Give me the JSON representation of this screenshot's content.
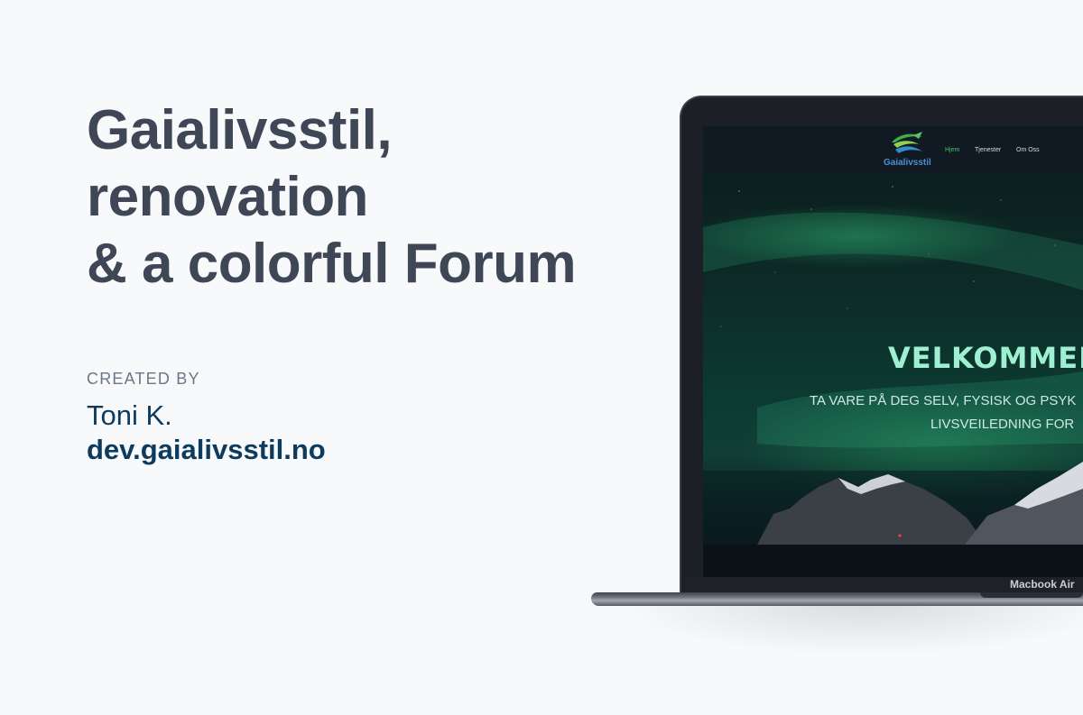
{
  "headline": {
    "line1": "Gaialivsstil,",
    "line2": "renovation",
    "line3": "& a colorful Forum"
  },
  "credits": {
    "label": "CREATED BY",
    "name": "Toni K.",
    "url": "dev.gaialivsstil.no"
  },
  "laptop": {
    "model_label": "Macbook Air"
  },
  "site": {
    "logo_text": "Gaialivsstil",
    "nav": [
      {
        "label": "Hjem",
        "active": true
      },
      {
        "label": "Tjenester",
        "active": false
      },
      {
        "label": "Om Oss",
        "active": false
      }
    ],
    "hero": {
      "title": "VELKOMMEN",
      "subtitle_line1": "TA VARE PÅ DEG SELV, FYSISK OG PSYK",
      "subtitle_line2": "LIVSVEILEDNING FOR"
    }
  },
  "colors": {
    "background": "#f7f9fb",
    "headline": "#3f4756",
    "credit_text": "#0d3b5e",
    "nav_active": "#48c06b",
    "hero_title": "#9ff0d2"
  }
}
